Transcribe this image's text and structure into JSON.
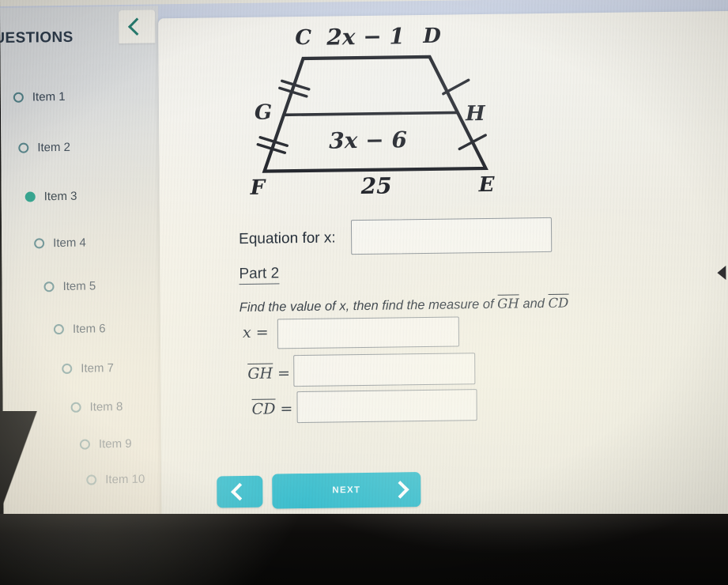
{
  "sidebar": {
    "title": "UESTIONS",
    "collapse_icon": "chevron-left-icon",
    "items": [
      {
        "label": "Item 1",
        "selected": false
      },
      {
        "label": "Item 2",
        "selected": false
      },
      {
        "label": "Item 3",
        "selected": true
      },
      {
        "label": "Item 4",
        "selected": false
      },
      {
        "label": "Item 5",
        "selected": false
      },
      {
        "label": "Item 6",
        "selected": false
      },
      {
        "label": "Item 7",
        "selected": false
      },
      {
        "label": "Item 8",
        "selected": false
      },
      {
        "label": "Item 9",
        "selected": false
      },
      {
        "label": "Item 10",
        "selected": false
      }
    ]
  },
  "figure": {
    "type": "trapezoid-with-midsegment",
    "vertices": {
      "C": "C",
      "D": "D",
      "E": "E",
      "F": "F",
      "G": "G",
      "H": "H"
    },
    "top_label": "2x − 1",
    "midsegment_label": "3x − 6",
    "bottom_label": "25",
    "left_leg_ticks": 2,
    "right_leg_ticks": 1
  },
  "question": {
    "equation_prompt": "Equation for x:",
    "equation_value": "",
    "equation_placeholder": "",
    "part_heading": "Part 2",
    "part_instruction_pre": "Find the value of x, then find the measure of",
    "part_instruction_seg1": "GH",
    "part_instruction_mid": "and",
    "part_instruction_seg2": "CD",
    "fields": [
      {
        "label": "x",
        "overline": false,
        "value": "",
        "placeholder": ""
      },
      {
        "label": "GH",
        "overline": true,
        "value": "",
        "placeholder": ""
      },
      {
        "label": "CD",
        "overline": true,
        "value": "",
        "placeholder": ""
      }
    ],
    "equals_sign": "="
  },
  "footer": {
    "prev_label": "",
    "prev_icon": "chevron-left-icon",
    "next_label": "NEXT",
    "next_icon": "chevron-right-icon"
  },
  "colors": {
    "accent_teal": "#3cbfcf",
    "selected_dot": "#1f9b86",
    "collapse_chevron": "#1f7a6c",
    "text": "#1d2733",
    "wall_green": "#246a4a",
    "chrome_lavender": "#c9d2e4"
  }
}
